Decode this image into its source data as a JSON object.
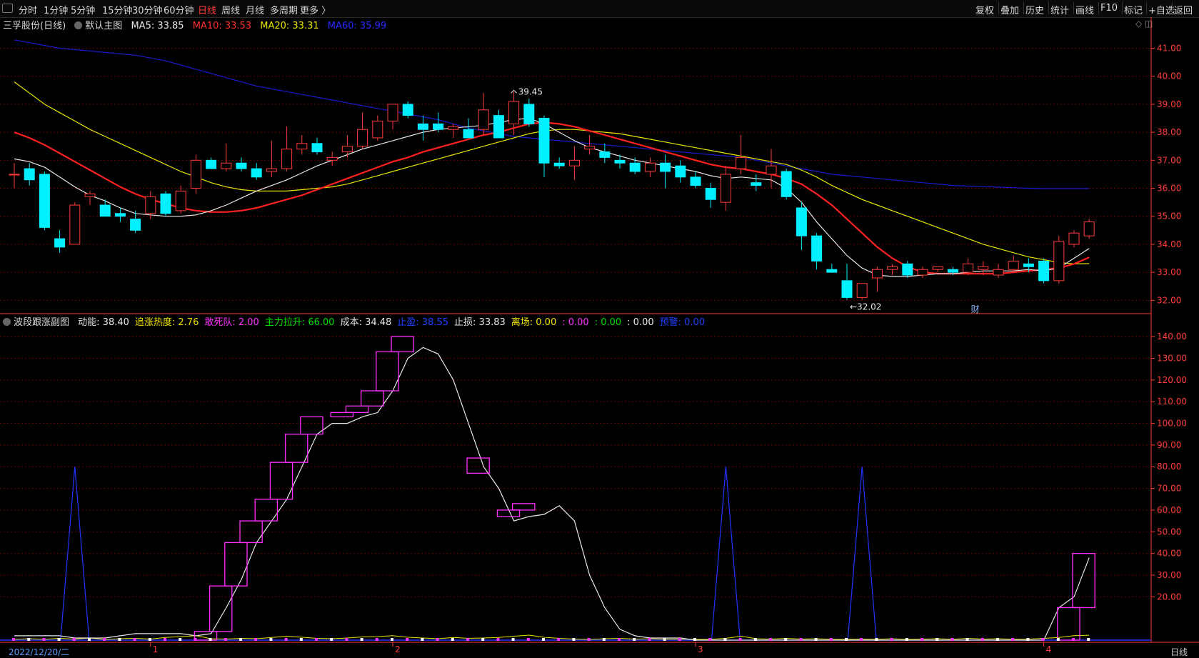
{
  "toolbar": {
    "periods": [
      "分时",
      "1分钟",
      "5分钟",
      "15分钟",
      "30分钟",
      "60分钟",
      "日线",
      "周线",
      "月线",
      "多周期",
      "更多 〉"
    ],
    "active_period": "日线",
    "right_items": [
      "复权",
      "叠加",
      "历史",
      "统计",
      "画线",
      "F10",
      "标记",
      "+自选",
      "返回"
    ]
  },
  "main_header": {
    "stock": "三孚股份(日线)",
    "template": "默认主图",
    "ma5": "MA5: 33.85",
    "ma10": "MA10: 33.53",
    "ma20": "MA20: 33.31",
    "ma60": "MA60: 35.99",
    "icons": "◇ ◫"
  },
  "sub_header": {
    "name": "波段跟涨副图",
    "items": [
      {
        "text": "动能: 38.40",
        "color": "#e6e6e6"
      },
      {
        "text": "追涨热度: 2.76",
        "color": "#f0e000"
      },
      {
        "text": "敢死队: 2.00",
        "color": "#ff30ff"
      },
      {
        "text": "主力拉升: 66.00",
        "color": "#00e000"
      },
      {
        "text": "成本: 34.48",
        "color": "#e6e6e6"
      },
      {
        "text": "止盈: 38.55",
        "color": "#2040ff"
      },
      {
        "text": "止损: 33.83",
        "color": "#e6e6e6"
      },
      {
        "text": "离场: 0.00",
        "color": "#f0e000"
      },
      {
        "text": ": 0.00",
        "color": "#ff30ff"
      },
      {
        "text": ": 0.00",
        "color": "#00e000"
      },
      {
        "text": ": 0.00",
        "color": "#e6e6e6"
      },
      {
        "text": "预警: 0.00",
        "color": "#2040ff"
      }
    ]
  },
  "colors": {
    "up": "#ff3b3b",
    "down": "#00f0ff",
    "ma5": "#e8e8e8",
    "ma10": "#ff2020",
    "ma20": "#e6e600",
    "ma60": "#1a1acc",
    "grid": "#6a0000",
    "axis": "#ff3b3b"
  },
  "chart_data": [
    {
      "type": "candlestick",
      "ylim": [
        31.6,
        41.6
      ],
      "y_ticks": [
        "41.00",
        "40.00",
        "39.00",
        "38.00",
        "37.00",
        "36.00",
        "35.00",
        "34.00",
        "33.00",
        "32.00"
      ],
      "annotations": {
        "high_label": "39.45",
        "low_label": "←32.02",
        "marker": "财"
      },
      "candles": [
        [
          36.5,
          36.9,
          36.0,
          36.5
        ],
        [
          36.7,
          36.9,
          36.1,
          36.3
        ],
        [
          36.5,
          36.6,
          34.5,
          34.6
        ],
        [
          34.2,
          34.5,
          33.7,
          33.9
        ],
        [
          34.0,
          35.5,
          34.0,
          35.4
        ],
        [
          35.7,
          35.9,
          35.4,
          35.8
        ],
        [
          35.4,
          35.6,
          35.0,
          35.0
        ],
        [
          35.1,
          35.3,
          34.8,
          35.0
        ],
        [
          34.9,
          35.2,
          34.4,
          34.5
        ],
        [
          35.1,
          35.9,
          34.9,
          35.7
        ],
        [
          35.8,
          35.9,
          35.0,
          35.1
        ],
        [
          35.2,
          36.1,
          35.1,
          35.9
        ],
        [
          36.0,
          37.2,
          35.8,
          37.0
        ],
        [
          37.0,
          37.1,
          36.7,
          36.7
        ],
        [
          36.7,
          37.6,
          36.6,
          36.9
        ],
        [
          36.9,
          37.1,
          36.6,
          36.7
        ],
        [
          36.7,
          36.9,
          36.3,
          36.4
        ],
        [
          36.6,
          37.7,
          36.4,
          36.7
        ],
        [
          36.7,
          38.2,
          36.6,
          37.4
        ],
        [
          37.4,
          37.9,
          37.2,
          37.6
        ],
        [
          37.6,
          37.8,
          37.2,
          37.3
        ],
        [
          37.0,
          37.3,
          36.8,
          37.1
        ],
        [
          37.3,
          37.9,
          37.1,
          37.5
        ],
        [
          37.5,
          38.7,
          37.4,
          38.1
        ],
        [
          37.8,
          38.6,
          37.7,
          38.4
        ],
        [
          38.4,
          38.9,
          38.1,
          39.0
        ],
        [
          39.0,
          39.1,
          38.5,
          38.6
        ],
        [
          38.3,
          38.6,
          37.7,
          38.1
        ],
        [
          38.3,
          38.7,
          38.0,
          38.1
        ],
        [
          38.1,
          38.3,
          37.8,
          38.2
        ],
        [
          38.1,
          38.5,
          37.8,
          37.8
        ],
        [
          38.1,
          39.4,
          37.9,
          38.8
        ],
        [
          38.6,
          38.8,
          37.8,
          37.8
        ],
        [
          38.3,
          39.45,
          37.9,
          39.1
        ],
        [
          39.0,
          39.2,
          38.2,
          38.3
        ],
        [
          38.5,
          38.6,
          36.4,
          36.9
        ],
        [
          36.9,
          37.1,
          36.7,
          36.8
        ],
        [
          36.8,
          37.5,
          36.3,
          37.0
        ],
        [
          37.4,
          37.9,
          37.2,
          37.5
        ],
        [
          37.3,
          37.6,
          36.9,
          37.1
        ],
        [
          37.0,
          37.2,
          36.7,
          36.9
        ],
        [
          36.9,
          37.1,
          36.5,
          36.6
        ],
        [
          36.6,
          37.1,
          36.4,
          36.9
        ],
        [
          36.9,
          37.2,
          36.0,
          36.6
        ],
        [
          36.8,
          37.0,
          36.2,
          36.4
        ],
        [
          36.4,
          36.6,
          36.0,
          36.1
        ],
        [
          36.0,
          36.2,
          35.3,
          35.6
        ],
        [
          35.5,
          36.8,
          35.2,
          36.5
        ],
        [
          36.7,
          37.9,
          36.5,
          37.1
        ],
        [
          36.2,
          36.5,
          35.9,
          36.1
        ],
        [
          36.5,
          37.4,
          36.0,
          36.8
        ],
        [
          36.6,
          36.7,
          35.6,
          35.7
        ],
        [
          35.3,
          35.5,
          33.8,
          34.3
        ],
        [
          34.3,
          34.4,
          33.1,
          33.4
        ],
        [
          33.1,
          33.3,
          33.0,
          33.0
        ],
        [
          32.7,
          33.3,
          32.02,
          32.1
        ],
        [
          32.1,
          32.6,
          32.02,
          32.6
        ],
        [
          32.8,
          33.2,
          32.3,
          33.1
        ],
        [
          33.1,
          33.3,
          32.9,
          33.2
        ],
        [
          33.3,
          33.4,
          32.8,
          32.9
        ],
        [
          32.9,
          33.2,
          32.8,
          33.1
        ],
        [
          33.1,
          33.2,
          33.0,
          33.2
        ],
        [
          33.1,
          33.2,
          32.9,
          33.0
        ],
        [
          33.0,
          33.5,
          32.9,
          33.3
        ],
        [
          33.1,
          33.4,
          32.9,
          33.2
        ],
        [
          32.9,
          33.3,
          32.8,
          33.1
        ],
        [
          33.1,
          33.6,
          33.0,
          33.4
        ],
        [
          33.3,
          33.5,
          33.0,
          33.2
        ],
        [
          33.4,
          33.5,
          32.6,
          32.7
        ],
        [
          32.7,
          34.3,
          32.6,
          34.1
        ],
        [
          34.0,
          34.5,
          33.9,
          34.4
        ],
        [
          34.3,
          34.9,
          34.2,
          34.8
        ]
      ],
      "ma5": [
        37.05,
        36.95,
        36.75,
        36.4,
        36.05,
        35.75,
        35.55,
        35.3,
        35.1,
        35.05,
        35.0,
        35.0,
        35.05,
        35.2,
        35.4,
        35.65,
        35.9,
        36.1,
        36.3,
        36.55,
        36.8,
        37.0,
        37.2,
        37.4,
        37.55,
        37.7,
        37.85,
        38.0,
        38.1,
        38.15,
        38.2,
        38.25,
        38.35,
        38.45,
        38.5,
        38.3,
        38.0,
        37.7,
        37.45,
        37.3,
        37.15,
        37.0,
        36.9,
        36.8,
        36.7,
        36.6,
        36.45,
        36.35,
        36.4,
        36.35,
        36.3,
        36.0,
        35.5,
        34.8,
        34.2,
        33.6,
        33.15,
        32.9,
        32.85,
        32.85,
        32.9,
        32.95,
        32.95,
        33.0,
        33.05,
        33.05,
        33.05,
        33.1,
        33.05,
        33.15,
        33.5,
        33.85
      ],
      "ma10": [
        38.0,
        37.8,
        37.55,
        37.25,
        36.95,
        36.65,
        36.35,
        36.05,
        35.8,
        35.6,
        35.45,
        35.3,
        35.2,
        35.15,
        35.15,
        35.2,
        35.3,
        35.45,
        35.6,
        35.75,
        35.95,
        36.15,
        36.35,
        36.55,
        36.75,
        36.95,
        37.1,
        37.3,
        37.45,
        37.6,
        37.75,
        37.9,
        38.0,
        38.15,
        38.3,
        38.35,
        38.3,
        38.2,
        38.05,
        37.9,
        37.75,
        37.6,
        37.45,
        37.3,
        37.15,
        37.0,
        36.85,
        36.75,
        36.7,
        36.6,
        36.5,
        36.35,
        36.15,
        35.8,
        35.4,
        34.9,
        34.4,
        33.9,
        33.5,
        33.2,
        33.0,
        32.95,
        32.95,
        32.95,
        32.95,
        32.95,
        33.0,
        33.05,
        33.1,
        33.15,
        33.3,
        33.53
      ],
      "ma20": [
        39.8,
        39.4,
        39.0,
        38.7,
        38.4,
        38.1,
        37.85,
        37.6,
        37.35,
        37.1,
        36.85,
        36.6,
        36.4,
        36.2,
        36.05,
        35.95,
        35.9,
        35.9,
        35.9,
        35.95,
        36.0,
        36.05,
        36.15,
        36.3,
        36.45,
        36.6,
        36.75,
        36.9,
        37.05,
        37.2,
        37.35,
        37.5,
        37.65,
        37.8,
        37.95,
        38.05,
        38.1,
        38.1,
        38.05,
        38.0,
        37.95,
        37.85,
        37.75,
        37.65,
        37.55,
        37.45,
        37.35,
        37.25,
        37.15,
        37.05,
        36.95,
        36.85,
        36.65,
        36.4,
        36.1,
        35.85,
        35.6,
        35.4,
        35.2,
        35.0,
        34.8,
        34.6,
        34.4,
        34.2,
        34.0,
        33.85,
        33.7,
        33.55,
        33.45,
        33.35,
        33.3,
        33.31
      ],
      "ma60": [
        41.3,
        41.2,
        41.1,
        41.0,
        40.95,
        40.9,
        40.85,
        40.8,
        40.75,
        40.65,
        40.55,
        40.4,
        40.25,
        40.1,
        39.95,
        39.8,
        39.65,
        39.55,
        39.45,
        39.35,
        39.25,
        39.15,
        39.05,
        38.95,
        38.85,
        38.75,
        38.65,
        38.55,
        38.45,
        38.3,
        38.15,
        38.05,
        37.95,
        37.85,
        37.8,
        37.75,
        37.7,
        37.65,
        37.6,
        37.55,
        37.5,
        37.45,
        37.4,
        37.35,
        37.3,
        37.25,
        37.2,
        37.15,
        37.1,
        37.0,
        36.9,
        36.8,
        36.7,
        36.6,
        36.5,
        36.45,
        36.4,
        36.35,
        36.3,
        36.25,
        36.2,
        36.15,
        36.1,
        36.08,
        36.06,
        36.04,
        36.02,
        36.0,
        35.99,
        35.99,
        35.99,
        35.99
      ]
    },
    {
      "type": "indicator",
      "ylim": [
        0,
        145
      ],
      "y_ticks": [
        "140.00",
        "130.00",
        "120.00",
        "110.00",
        "100.00",
        "90.00",
        "80.00",
        "70.00",
        "60.00",
        "50.00",
        "40.00",
        "30.00",
        "20.00"
      ],
      "momentum": [
        2,
        2,
        2,
        2,
        1,
        1,
        1,
        2,
        3,
        3,
        3,
        3,
        2,
        3,
        15,
        28,
        45,
        55,
        65,
        80,
        95,
        100,
        100,
        103,
        105,
        115,
        130,
        135,
        132,
        120,
        100,
        80,
        70,
        55,
        57,
        58,
        62,
        55,
        30,
        15,
        5,
        2,
        1,
        1,
        1,
        0,
        0,
        0,
        0,
        0,
        0,
        0,
        0,
        0,
        0,
        0,
        0,
        0,
        0,
        0,
        0,
        0,
        0,
        0,
        0,
        0,
        0,
        0,
        0,
        15,
        20,
        38
      ],
      "boxes": [
        [
          12,
          13,
          0,
          4
        ],
        [
          13,
          14,
          4,
          25
        ],
        [
          14,
          15,
          25,
          45
        ],
        [
          15,
          16,
          45,
          55
        ],
        [
          16,
          17,
          55,
          65
        ],
        [
          17,
          18,
          65,
          82
        ],
        [
          18,
          19,
          82,
          95
        ],
        [
          19,
          20,
          95,
          103
        ],
        [
          21,
          22,
          103,
          105
        ],
        [
          22,
          23,
          105,
          108
        ],
        [
          23,
          24,
          108,
          115
        ],
        [
          24,
          25,
          115,
          133
        ],
        [
          25,
          26,
          133,
          140
        ],
        [
          30,
          31,
          77,
          84
        ],
        [
          32,
          33,
          57,
          60
        ],
        [
          33,
          34,
          60,
          63
        ],
        [
          69,
          70,
          0,
          15
        ],
        [
          70,
          71,
          15,
          40
        ]
      ],
      "spikes": [
        4,
        47,
        56
      ],
      "spike_value": 80,
      "heat": [
        0.5,
        0.8,
        0.5,
        1,
        0.6,
        1.2,
        0.4,
        0.8,
        1,
        0.6,
        1.5,
        2,
        2.5,
        0.8,
        0.6,
        1,
        0.8,
        1.5,
        2.2,
        1.6,
        1,
        0.8,
        1.2,
        1.8,
        2,
        2.5,
        1.6,
        1.2,
        0.8,
        1.5,
        1,
        1.2,
        1.5,
        2.2,
        2.8,
        1.6,
        1,
        0.6,
        0.4,
        0.8,
        1,
        0.6,
        0.8,
        0.5,
        0.6,
        0.4,
        0.5,
        1,
        2.2,
        0.8,
        0.6,
        1,
        0.6,
        0.8,
        0.5,
        0.4,
        0.6,
        0.5,
        0.8,
        0.4,
        0.6,
        0.8,
        0.5,
        1,
        0.6,
        0.8,
        0.5,
        0.6,
        1,
        1.5,
        2.5,
        2.76
      ],
      "x_ticks": [
        {
          "i": 9,
          "label": "1"
        },
        {
          "i": 25,
          "label": "2"
        },
        {
          "i": 45,
          "label": "3"
        },
        {
          "i": 68,
          "label": "4"
        }
      ]
    }
  ],
  "status": {
    "date": "2022/12/20/二",
    "period": "日线"
  }
}
